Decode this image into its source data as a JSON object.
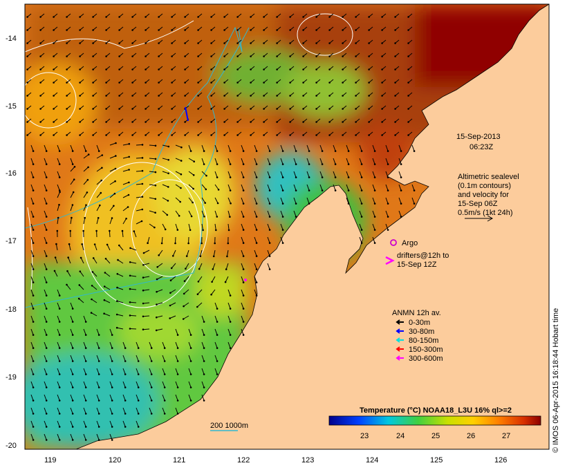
{
  "map": {
    "datetime_line1": "15-Sep-2013",
    "datetime_line2": "06:23Z",
    "altimetry_lines": [
      "Altimetric sealevel",
      "(0.1m contours)",
      "and velocity for",
      "15-Sep 06Z",
      "0.5m/s (1kt 24h)"
    ],
    "argo_label": "Argo",
    "drifters_lines": [
      "drifters@12h to",
      "15-Sep 12Z"
    ],
    "anmn_title": "ANMN 12h av.",
    "anmn_legend": [
      {
        "label": "0-30m",
        "color": "#000000"
      },
      {
        "label": "30-80m",
        "color": "#0000ff"
      },
      {
        "label": "80-150m",
        "color": "#00e0e0"
      },
      {
        "label": "150-300m",
        "color": "#ff0000"
      },
      {
        "label": "300-600m",
        "color": "#ff00ff"
      }
    ],
    "bathymetry_label": "200  1000m",
    "colorbar": {
      "title": "Temperature (°C) NOAA18_L3U 16% ql>=2",
      "ticks": [
        "23",
        "24",
        "25",
        "26",
        "27"
      ],
      "range": [
        22,
        28
      ]
    },
    "lat_ticks": [
      "-14",
      "-15",
      "-16",
      "-17",
      "-18",
      "-19",
      "-20"
    ],
    "lon_ticks": [
      "119",
      "120",
      "121",
      "122",
      "123",
      "124",
      "125",
      "126"
    ],
    "credit": "© IMOS 06-Apr-2015 16:18:44 Hobart time",
    "colors": {
      "land": "#fccc9c",
      "argo": "#cc00cc",
      "drifter": "#ff00ff",
      "warm": "#b01e00",
      "cool": "#30c0c0"
    }
  }
}
